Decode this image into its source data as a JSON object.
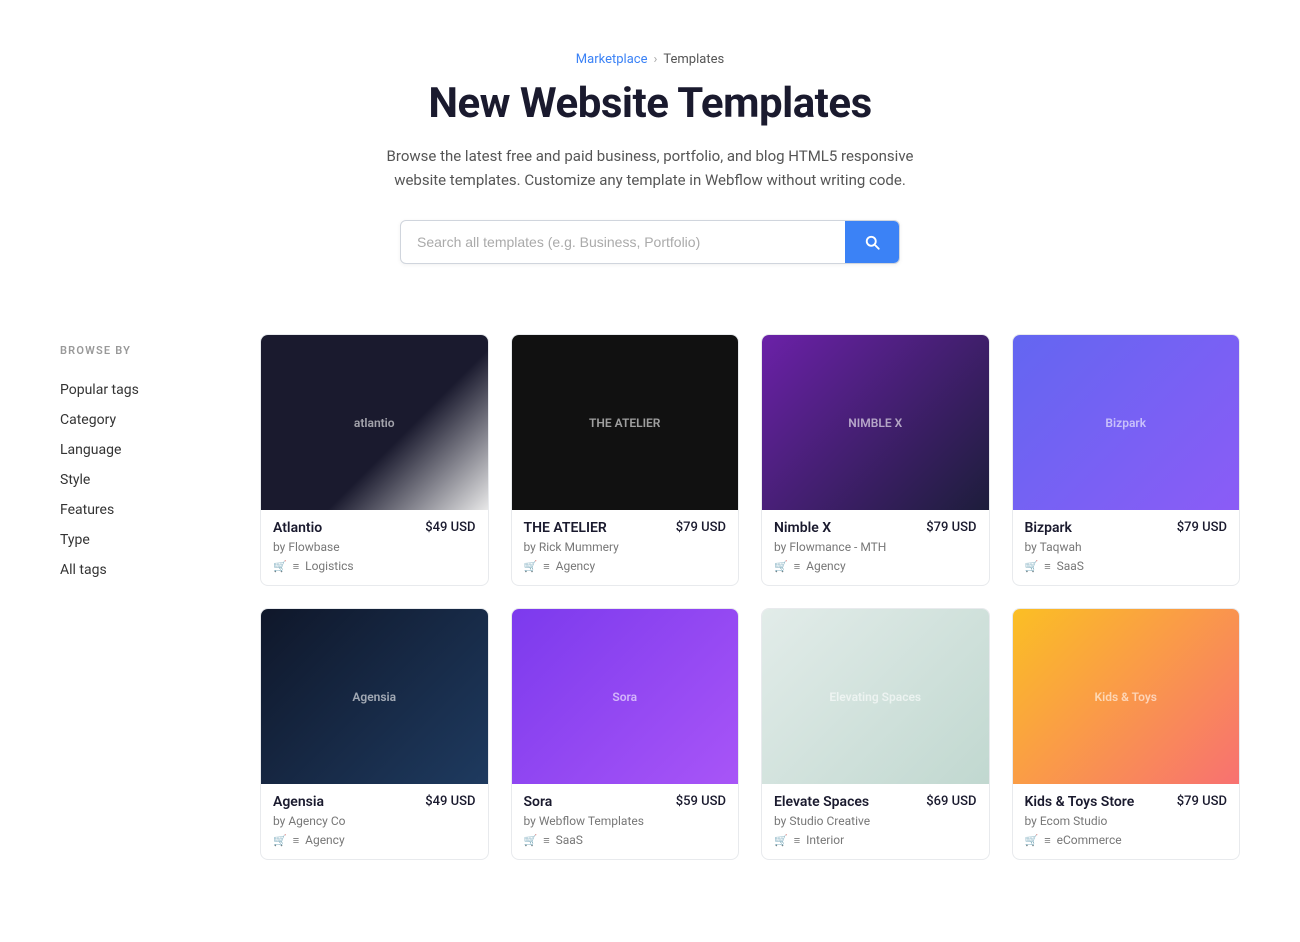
{
  "breadcrumb": {
    "marketplace_label": "Marketplace",
    "separator": "›",
    "current": "Templates"
  },
  "hero": {
    "title": "New Website Templates",
    "description": "Browse the latest free and paid business, portfolio, and blog HTML5 responsive website templates. Customize any template in Webflow without writing code."
  },
  "search": {
    "placeholder": "Search all templates (e.g. Business, Portfolio)",
    "button_label": "Search"
  },
  "sidebar": {
    "browse_label": "BROWSE BY",
    "items": [
      {
        "label": "Popular tags"
      },
      {
        "label": "Category"
      },
      {
        "label": "Language"
      },
      {
        "label": "Style"
      },
      {
        "label": "Features"
      },
      {
        "label": "Type"
      },
      {
        "label": "All tags"
      }
    ]
  },
  "templates": {
    "row1": [
      {
        "name": "Atlantio",
        "price": "$49 USD",
        "author": "by Flowbase",
        "tag": "Logistics",
        "thumb_class": "thumb-atlantio",
        "thumb_text": "atlantio"
      },
      {
        "name": "THE ATELIER",
        "price": "$79 USD",
        "author": "by Rick Mummery",
        "tag": "Agency",
        "thumb_class": "thumb-atelier",
        "thumb_text": "THE ATELIER"
      },
      {
        "name": "Nimble X",
        "price": "$79 USD",
        "author": "by Flowmance - MTH",
        "tag": "Agency",
        "thumb_class": "thumb-nimble",
        "thumb_text": "NIMBLE X"
      },
      {
        "name": "Bizpark",
        "price": "$79 USD",
        "author": "by Taqwah",
        "tag": "SaaS",
        "thumb_class": "thumb-bizpark",
        "thumb_text": "Bizpark"
      }
    ],
    "row2": [
      {
        "name": "Agensia",
        "price": "$49 USD",
        "author": "by Agency Co",
        "tag": "Agency",
        "thumb_class": "thumb-agensia",
        "thumb_text": "Agensia"
      },
      {
        "name": "Sora",
        "price": "$59 USD",
        "author": "by Webflow Templates",
        "tag": "SaaS",
        "thumb_class": "thumb-sora",
        "thumb_text": "Sora"
      },
      {
        "name": "Elevate Spaces",
        "price": "$69 USD",
        "author": "by Studio Creative",
        "tag": "Interior",
        "thumb_class": "thumb-elevate",
        "thumb_text": "Elevating Spaces"
      },
      {
        "name": "Kids & Toys Store",
        "price": "$79 USD",
        "author": "by Ecom Studio",
        "tag": "eCommerce",
        "thumb_class": "thumb-kids",
        "thumb_text": "Kids & Toys"
      }
    ]
  }
}
